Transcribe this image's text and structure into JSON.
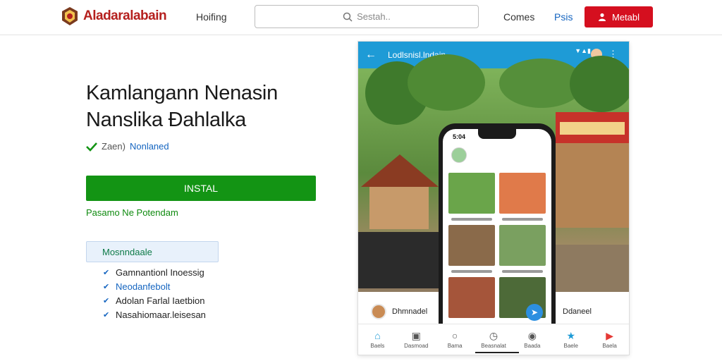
{
  "header": {
    "brand": "Aladaralabain",
    "nav_home": "Hoifing",
    "search_placeholder": "Sestah..",
    "nav_games": "Comes",
    "nav_psis": "Psis",
    "login_label": "Metabl"
  },
  "app": {
    "title_line1": "Kamlangann Nenasin",
    "title_line2": "Nanslika Ðahlalka",
    "verify_prefix": "Zaen)",
    "verify_link": "Nonlaned",
    "install_label": "INSTAL",
    "subnote": "Pasamo Ne Potendam",
    "features_heading": "Mosnndaale",
    "features": [
      "Gamnantionl Inoessig",
      "Neodanfebolt",
      "Adolan Farlal Iaetbion",
      "Nasahiomaar.leisesan"
    ]
  },
  "screenshot": {
    "toolbar_title": "Lodlsnisl.lndain",
    "phone_time": "5:04",
    "card_left_label": "Dhmnadel",
    "card_right_label": "Ddaneel",
    "bottom_nav": [
      {
        "label": "Baels",
        "icon": "home-icon"
      },
      {
        "label": "Dasmoad",
        "icon": "info-icon"
      },
      {
        "label": "Bama",
        "icon": "search-icon"
      },
      {
        "label": "Beasnalat",
        "icon": "timer-icon"
      },
      {
        "label": "Baada",
        "icon": "gamepad-icon"
      },
      {
        "label": "Baele",
        "icon": "star-icon"
      },
      {
        "label": "Baela",
        "icon": "youtube-icon"
      }
    ]
  },
  "colors": {
    "brand_red": "#b5201e",
    "install_green": "#139414",
    "toolbar_blue": "#1e9bd6",
    "login_red": "#d50f1f"
  }
}
